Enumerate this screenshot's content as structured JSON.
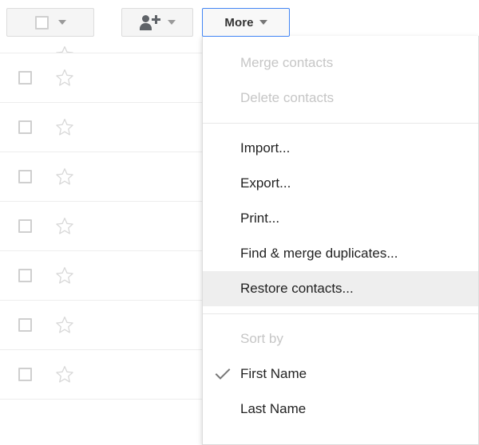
{
  "toolbar": {
    "select_all_button": {
      "name": "select-all-dropdown",
      "checkbox_icon": "checkbox-icon",
      "caret_icon": "chevron-down-icon"
    },
    "add_contact_button": {
      "name": "add-contact-dropdown",
      "person_icon": "person-add-icon",
      "caret_icon": "chevron-down-icon"
    },
    "more_button": {
      "label": "More",
      "caret_icon": "chevron-down-icon",
      "active_border_color": "#4285f4"
    }
  },
  "menu": {
    "items": [
      {
        "label": "Merge contacts",
        "state": "disabled",
        "checked": false
      },
      {
        "label": "Delete contacts",
        "state": "disabled",
        "checked": false
      },
      {
        "separator": true
      },
      {
        "label": "Import...",
        "state": "enabled",
        "checked": false
      },
      {
        "label": "Export...",
        "state": "enabled",
        "checked": false
      },
      {
        "label": "Print...",
        "state": "enabled",
        "checked": false
      },
      {
        "label": "Find & merge duplicates...",
        "state": "enabled",
        "checked": false
      },
      {
        "label": "Restore contacts...",
        "state": "highlight",
        "checked": false
      },
      {
        "separator": true
      },
      {
        "label": "Sort by",
        "state": "disabled",
        "checked": false
      },
      {
        "label": "First Name",
        "state": "enabled",
        "checked": true
      },
      {
        "label": "Last Name",
        "state": "enabled",
        "checked": false
      }
    ],
    "check_icon": "check-icon",
    "highlight_color": "#eeeeee",
    "disabled_color": "#c6c6c6",
    "text_color": "#222222"
  },
  "contact_list": {
    "rows": [
      {
        "partial": true,
        "checkbox_icon": "checkbox-icon",
        "star_icon": "star-outline-icon"
      },
      {
        "partial": false,
        "checkbox_icon": "checkbox-icon",
        "star_icon": "star-outline-icon"
      },
      {
        "partial": false,
        "checkbox_icon": "checkbox-icon",
        "star_icon": "star-outline-icon"
      },
      {
        "partial": false,
        "checkbox_icon": "checkbox-icon",
        "star_icon": "star-outline-icon"
      },
      {
        "partial": false,
        "checkbox_icon": "checkbox-icon",
        "star_icon": "star-outline-icon"
      },
      {
        "partial": false,
        "checkbox_icon": "checkbox-icon",
        "star_icon": "star-outline-icon"
      },
      {
        "partial": false,
        "checkbox_icon": "checkbox-icon",
        "star_icon": "star-outline-icon"
      },
      {
        "partial": false,
        "checkbox_icon": "checkbox-icon",
        "star_icon": "star-outline-icon"
      }
    ]
  }
}
